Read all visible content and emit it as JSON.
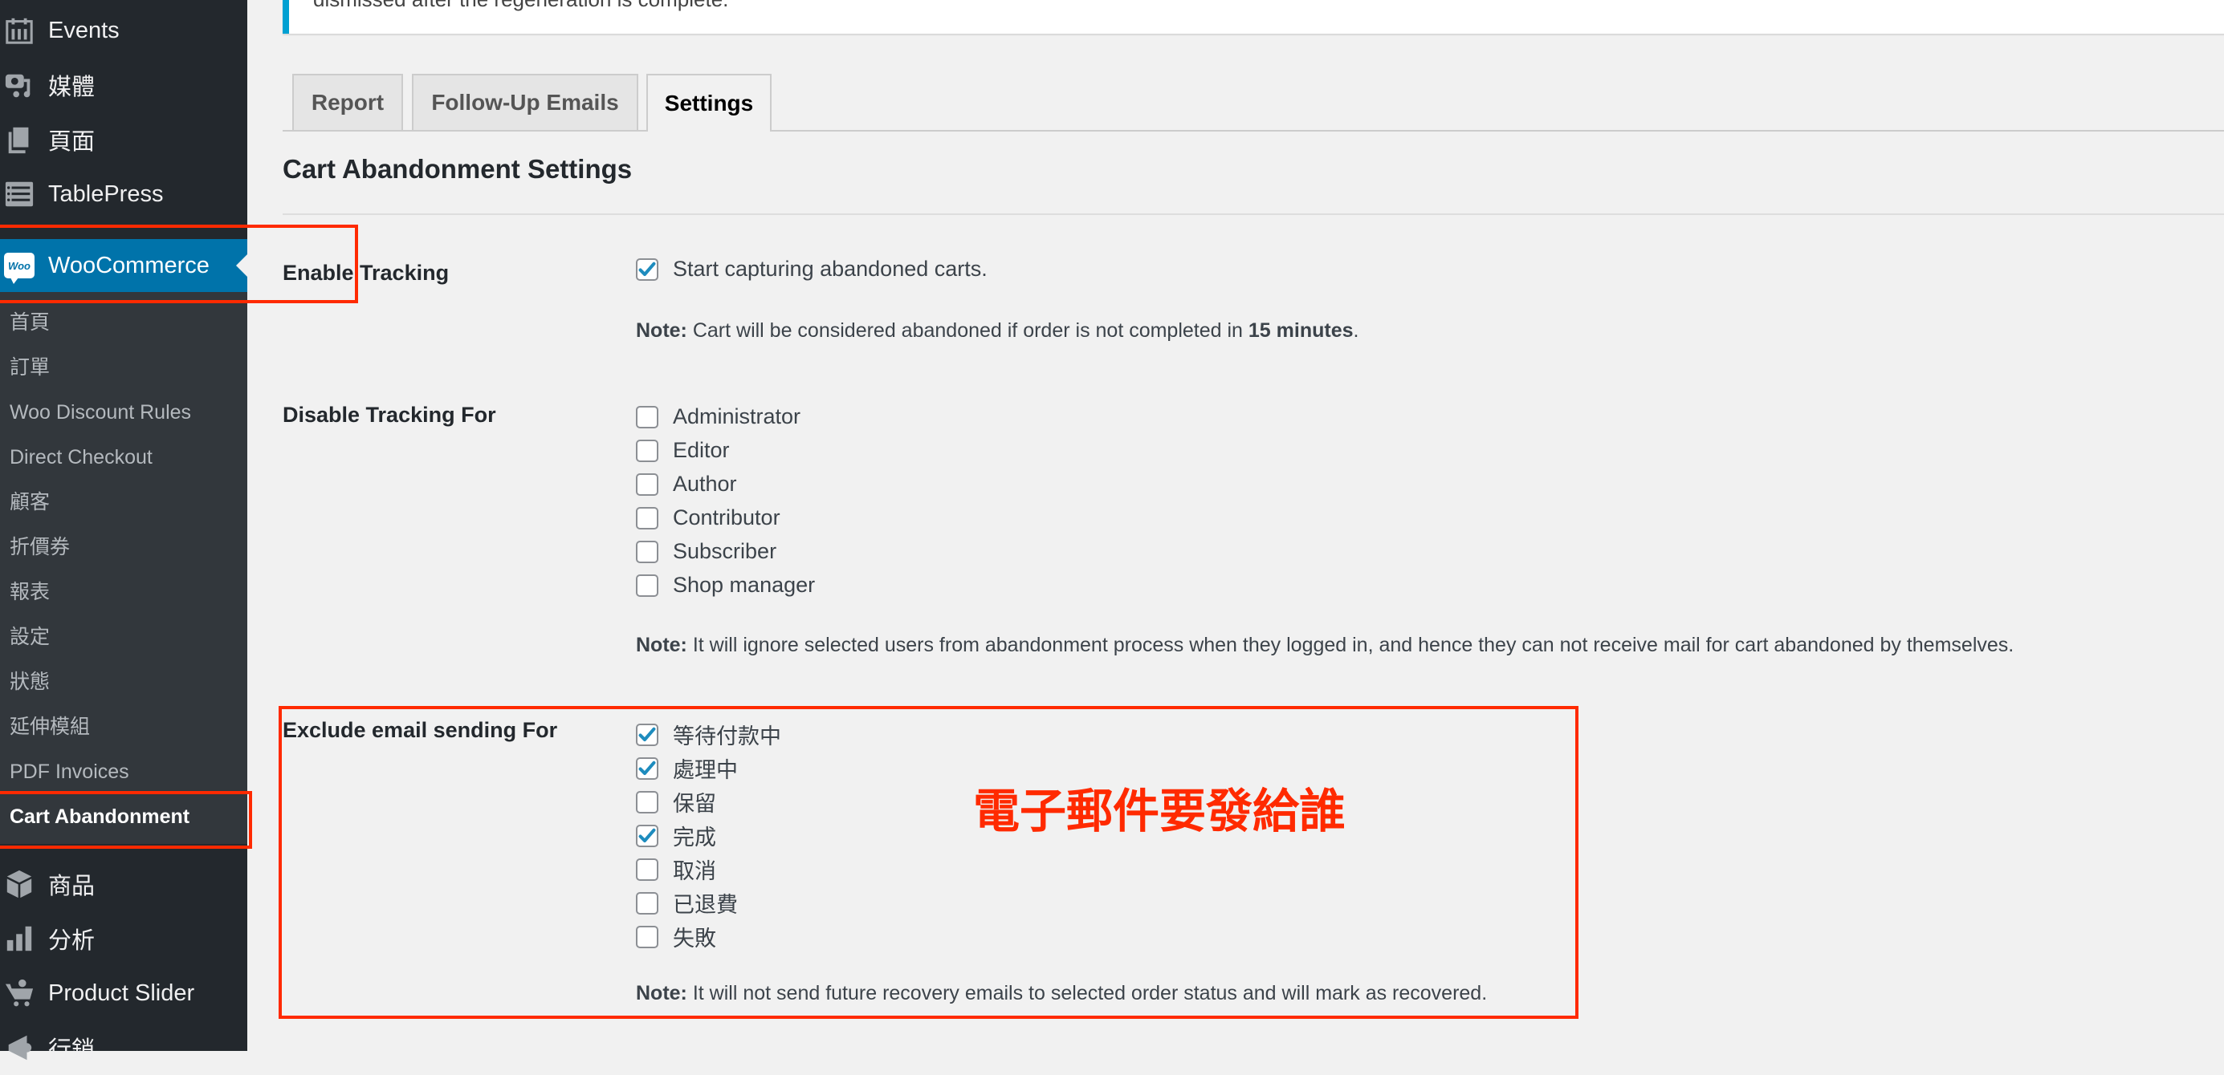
{
  "sidebar": {
    "top_items": [
      {
        "label": "Events",
        "icon": "calendar-icon"
      },
      {
        "label": "媒體",
        "icon": "media-icon"
      },
      {
        "label": "頁面",
        "icon": "pages-icon"
      },
      {
        "label": "TablePress",
        "icon": "table-icon"
      }
    ],
    "active": {
      "label": "WooCommerce",
      "icon": "woocommerce-icon",
      "badge": "Woo"
    },
    "submenu": [
      "首頁",
      "訂單",
      "Woo Discount Rules",
      "Direct Checkout",
      "顧客",
      "折價券",
      "報表",
      "設定",
      "狀態",
      "延伸模組",
      "PDF Invoices",
      "Cart Abandonment"
    ],
    "current_submenu": "Cart Abandonment",
    "bottom_items": [
      {
        "label": "商品",
        "icon": "box-icon"
      },
      {
        "label": "分析",
        "icon": "analytics-icon"
      },
      {
        "label": "Product Slider",
        "icon": "cart-gear-icon"
      },
      {
        "label": "行銷",
        "icon": "megaphone-icon"
      }
    ]
  },
  "notice": {
    "text": "dismissed after the regeneration is complete."
  },
  "tabs": [
    {
      "label": "Report",
      "active": false
    },
    {
      "label": "Follow-Up Emails",
      "active": false
    },
    {
      "label": "Settings",
      "active": true
    }
  ],
  "page_title": "Cart Abandonment Settings",
  "settings": {
    "enable_tracking": {
      "label": "Enable Tracking",
      "checkbox_label": "Start capturing abandoned carts.",
      "checked": true,
      "note_prefix": "Note:",
      "note_text": " Cart will be considered abandoned if order is not completed in ",
      "note_bold": "15 minutes",
      "note_suffix": "."
    },
    "disable_tracking": {
      "label": "Disable Tracking For",
      "options": [
        {
          "label": "Administrator",
          "checked": false
        },
        {
          "label": "Editor",
          "checked": false
        },
        {
          "label": "Author",
          "checked": false
        },
        {
          "label": "Contributor",
          "checked": false
        },
        {
          "label": "Subscriber",
          "checked": false
        },
        {
          "label": "Shop manager",
          "checked": false
        }
      ],
      "note_prefix": "Note:",
      "note_text": " It will ignore selected users from abandonment process when they logged in, and hence they can not receive mail for cart abandoned by themselves."
    },
    "exclude_email": {
      "label": "Exclude email sending For",
      "options": [
        {
          "label": "等待付款中",
          "checked": true
        },
        {
          "label": "處理中",
          "checked": true
        },
        {
          "label": "保留",
          "checked": false
        },
        {
          "label": "完成",
          "checked": true
        },
        {
          "label": "取消",
          "checked": false
        },
        {
          "label": "已退費",
          "checked": false
        },
        {
          "label": "失敗",
          "checked": false
        }
      ],
      "note_prefix": "Note:",
      "note_text": " It will not send future recovery emails to selected order status and will mark as recovered."
    }
  },
  "annotation": {
    "text": "電子郵件要發給誰",
    "color": "#ff2a00"
  },
  "colors": {
    "accent": "#0073aa",
    "check": "#1e8cbe",
    "sidebar": "#23282d",
    "submenu": "#32373c"
  }
}
